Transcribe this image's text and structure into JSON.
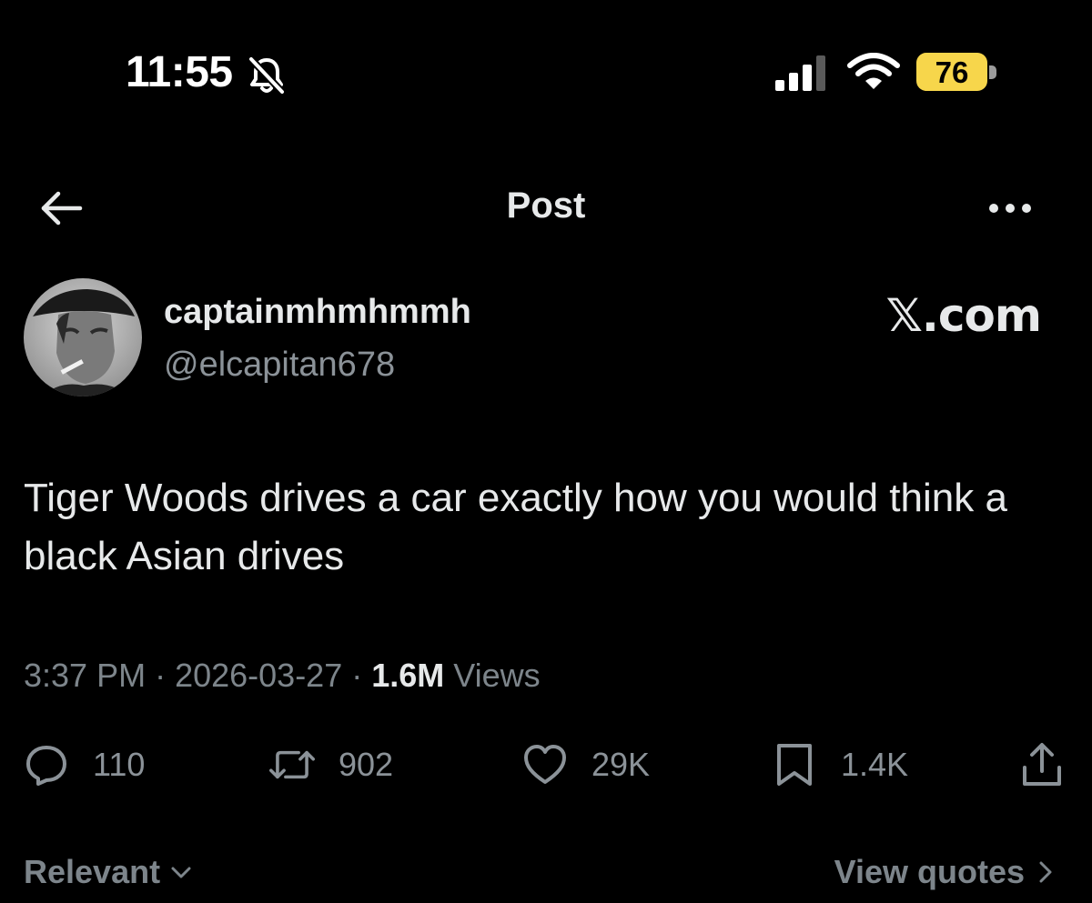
{
  "status_bar": {
    "time": "11:55",
    "battery_percent": "76",
    "battery_color": "#f7d64b",
    "icons": [
      "bell-slash-icon",
      "signal-icon",
      "wifi-icon",
      "battery-icon"
    ]
  },
  "nav": {
    "title": "Post",
    "icons": [
      "back-arrow-icon",
      "more-icon"
    ]
  },
  "post": {
    "display_name": "captainmhmhmmh",
    "handle": "@elcapitan678",
    "source": "𝕏.com",
    "text": "Tiger Woods drives a car exactly how you would think a black Asian drives",
    "time": "3:37 PM",
    "separator": " · ",
    "date": "2026-03-27",
    "views_count": "1.6M",
    "views_label": "Views"
  },
  "actions": {
    "replies": "110",
    "reposts": "902",
    "likes": "29K",
    "bookmarks": "1.4K",
    "icons": [
      "reply-icon",
      "repost-icon",
      "like-icon",
      "bookmark-icon",
      "share-icon"
    ]
  },
  "footer": {
    "sort_label": "Relevant",
    "view_quotes_label": "View quotes"
  }
}
